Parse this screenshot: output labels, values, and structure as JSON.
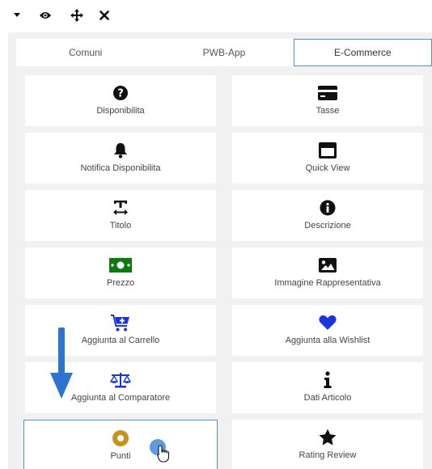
{
  "toolbar": {
    "icons": [
      "caret-down-icon",
      "eye-icon",
      "move-icon",
      "close-icon"
    ]
  },
  "tabs": [
    {
      "label": "Comuni",
      "active": false
    },
    {
      "label": "PWB-App",
      "active": false
    },
    {
      "label": "E-Commerce",
      "active": true
    }
  ],
  "widgets": [
    {
      "label": "Disponibilita",
      "icon": "question-circle-icon",
      "color": "#111111"
    },
    {
      "label": "Tasse",
      "icon": "credit-card-icon",
      "color": "#111111"
    },
    {
      "label": "Notifica Disponibilita",
      "icon": "bell-icon",
      "color": "#111111"
    },
    {
      "label": "Quick View",
      "icon": "window-icon",
      "color": "#111111"
    },
    {
      "label": "Titolo",
      "icon": "text-width-icon",
      "color": "#111111"
    },
    {
      "label": "Descrizione",
      "icon": "info-circle-icon",
      "color": "#111111"
    },
    {
      "label": "Prezzo",
      "icon": "money-bill-icon",
      "color": "#0d7a0d"
    },
    {
      "label": "Immagine Rappresentativa",
      "icon": "image-icon",
      "color": "#111111"
    },
    {
      "label": "Aggiunta al Carrello",
      "icon": "cart-plus-icon",
      "color": "#1a35e0"
    },
    {
      "label": "Aggiunta alla Wishlist",
      "icon": "heart-icon",
      "color": "#1a35e0"
    },
    {
      "label": "Aggiunta al Comparatore",
      "icon": "balance-scale-icon",
      "color": "#1a35e0"
    },
    {
      "label": "Dati Articolo",
      "icon": "info-icon",
      "color": "#111111"
    },
    {
      "label": "Punti",
      "icon": "coin-icon",
      "color": "#c8911b",
      "selected": true
    },
    {
      "label": "Rating Review",
      "icon": "star-icon",
      "color": "#111111"
    }
  ],
  "overlay": {
    "arrow_color": "#2d74d0",
    "cursor_dot_color": "#4f8fd6"
  }
}
